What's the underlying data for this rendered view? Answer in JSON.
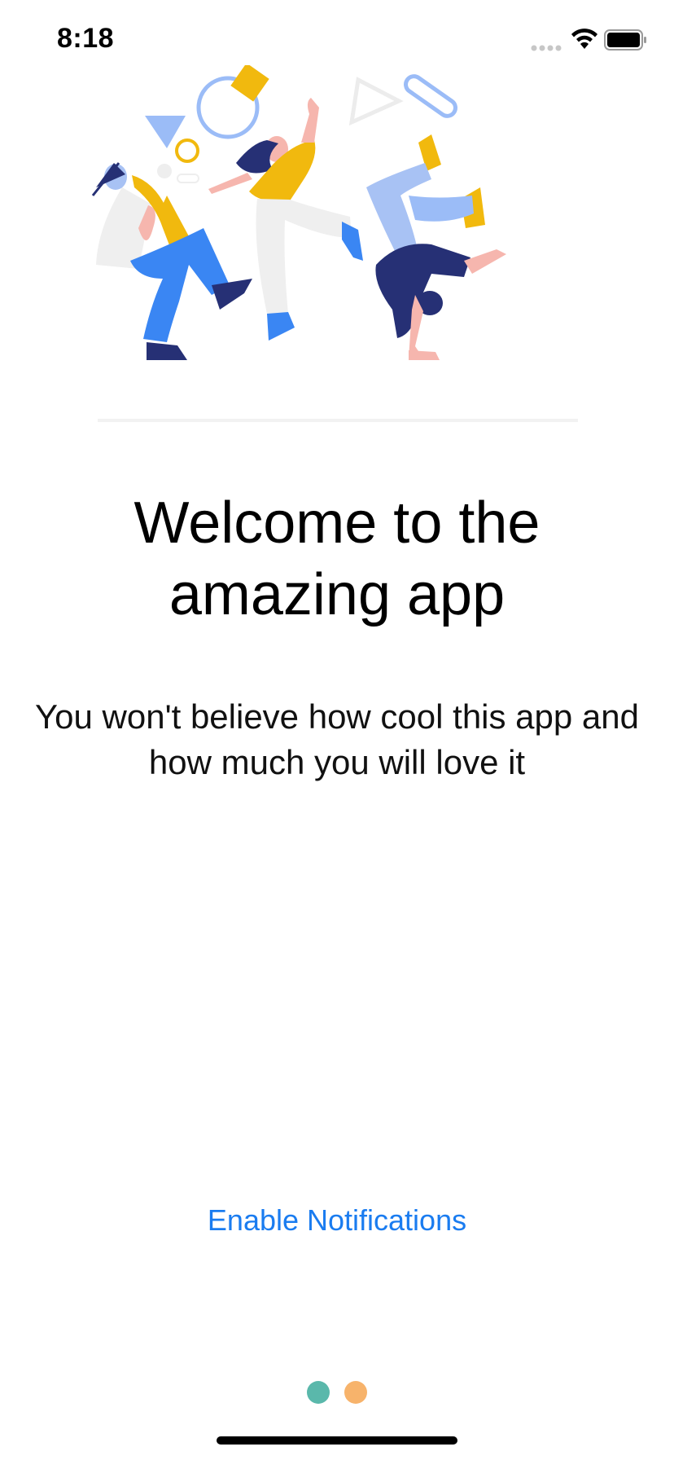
{
  "status_bar": {
    "time": "8:18",
    "icons": [
      "cellular-signal-icon",
      "wifi-icon",
      "battery-icon"
    ]
  },
  "illustration": {
    "name": "dancing-people-illustration"
  },
  "onboarding": {
    "title": "Welcome to the amazing app",
    "subtitle": "You won't believe how cool this app and how much you will love it",
    "primary_action_label": "Enable Notifications"
  },
  "page_indicator": {
    "pages": 2,
    "current": 1,
    "dot_colors": [
      "#5ab8ab",
      "#f7b36b"
    ]
  },
  "colors": {
    "accent": "#1a7cf0",
    "text": "#000000",
    "background": "#ffffff"
  }
}
